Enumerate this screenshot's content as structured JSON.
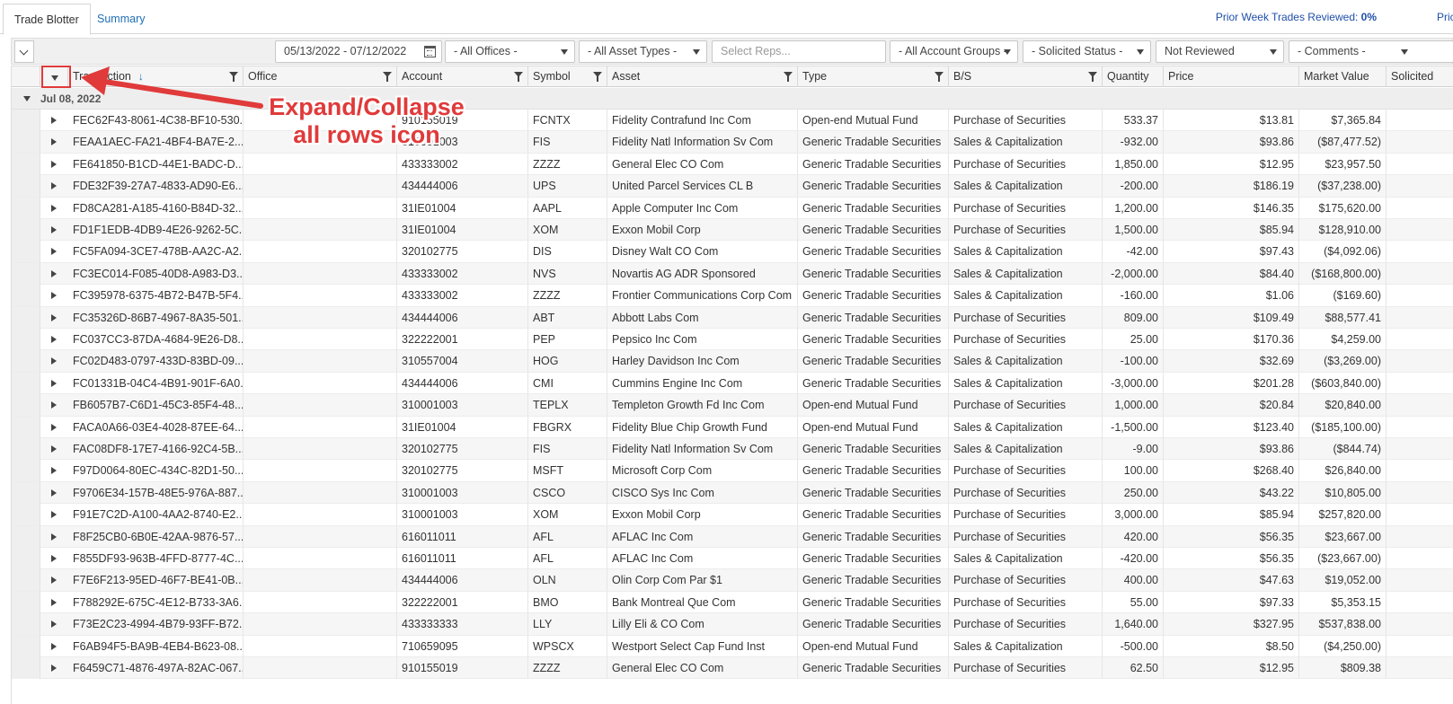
{
  "tabs": [
    {
      "label": "Trade Blotter",
      "active": true
    },
    {
      "label": "Summary",
      "active": false
    }
  ],
  "prior_week": {
    "label": "Prior Week Trades Reviewed: ",
    "value": "0%",
    "truncated": "Pric"
  },
  "toolbar": {
    "date_range": "05/13/2022 - 07/12/2022",
    "offices": "- All Offices -",
    "asset_types": "- All Asset Types -",
    "reps_placeholder": "Select Reps...",
    "account_groups": "- All Account Groups -",
    "solicited": "- Solicited Status -",
    "review": "Not Reviewed",
    "comments": "- Comments -"
  },
  "columns": [
    "Transaction",
    "Office",
    "Account",
    "Symbol",
    "Asset",
    "Type",
    "B/S",
    "Quantity",
    "Price",
    "Market Value",
    "Solicited"
  ],
  "group_label": "Jul 08, 2022",
  "annotation": {
    "line1": "Expand/Collapse",
    "line2": "all rows icon"
  },
  "rows": [
    [
      "FEC62F43-8061-4C38-BF10-530...",
      "",
      "910155019",
      "FCNTX",
      "Fidelity Contrafund Inc Com",
      "Open-end Mutual Fund",
      "Purchase of Securities",
      "533.37",
      "$13.81",
      "$7,365.84"
    ],
    [
      "FEAA1AEC-FA21-4BF4-BA7E-2...",
      "",
      "310001003",
      "FIS",
      "Fidelity Natl Information Sv Com",
      "Generic Tradable Securities",
      "Sales & Capitalization",
      "-932.00",
      "$93.86",
      "($87,477.52)"
    ],
    [
      "FE641850-B1CD-44E1-BADC-D...",
      "",
      "433333002",
      "ZZZZ",
      "General Elec CO Com",
      "Generic Tradable Securities",
      "Purchase of Securities",
      "1,850.00",
      "$12.95",
      "$23,957.50"
    ],
    [
      "FDE32F39-27A7-4833-AD90-E6...",
      "",
      "434444006",
      "UPS",
      "United Parcel Services CL B",
      "Generic Tradable Securities",
      "Sales & Capitalization",
      "-200.00",
      "$186.19",
      "($37,238.00)"
    ],
    [
      "FD8CA281-A185-4160-B84D-32...",
      "",
      "31IE01004",
      "AAPL",
      "Apple Computer Inc Com",
      "Generic Tradable Securities",
      "Purchase of Securities",
      "1,200.00",
      "$146.35",
      "$175,620.00"
    ],
    [
      "FD1F1EDB-4DB9-4E26-9262-5C...",
      "",
      "31IE01004",
      "XOM",
      "Exxon Mobil Corp",
      "Generic Tradable Securities",
      "Purchase of Securities",
      "1,500.00",
      "$85.94",
      "$128,910.00"
    ],
    [
      "FC5FA094-3CE7-478B-AA2C-A2...",
      "",
      "320102775",
      "DIS",
      "Disney Walt CO Com",
      "Generic Tradable Securities",
      "Sales & Capitalization",
      "-42.00",
      "$97.43",
      "($4,092.06)"
    ],
    [
      "FC3EC014-F085-40D8-A983-D3...",
      "",
      "433333002",
      "NVS",
      "Novartis AG ADR Sponsored",
      "Generic Tradable Securities",
      "Sales & Capitalization",
      "-2,000.00",
      "$84.40",
      "($168,800.00)"
    ],
    [
      "FC395978-6375-4B72-B47B-5F4...",
      "",
      "433333002",
      "ZZZZ",
      "Frontier Communications Corp Com",
      "Generic Tradable Securities",
      "Sales & Capitalization",
      "-160.00",
      "$1.06",
      "($169.60)"
    ],
    [
      "FC35326D-86B7-4967-8A35-501...",
      "",
      "434444006",
      "ABT",
      "Abbott Labs Com",
      "Generic Tradable Securities",
      "Purchase of Securities",
      "809.00",
      "$109.49",
      "$88,577.41"
    ],
    [
      "FC037CC3-87DA-4684-9E26-D8...",
      "",
      "322222001",
      "PEP",
      "Pepsico Inc Com",
      "Generic Tradable Securities",
      "Purchase of Securities",
      "25.00",
      "$170.36",
      "$4,259.00"
    ],
    [
      "FC02D483-0797-433D-83BD-09...",
      "",
      "310557004",
      "HOG",
      "Harley Davidson Inc Com",
      "Generic Tradable Securities",
      "Sales & Capitalization",
      "-100.00",
      "$32.69",
      "($3,269.00)"
    ],
    [
      "FC01331B-04C4-4B91-901F-6A0...",
      "",
      "434444006",
      "CMI",
      "Cummins Engine Inc Com",
      "Generic Tradable Securities",
      "Sales & Capitalization",
      "-3,000.00",
      "$201.28",
      "($603,840.00)"
    ],
    [
      "FB6057B7-C6D1-45C3-85F4-48...",
      "",
      "310001003",
      "TEPLX",
      "Templeton Growth Fd Inc Com",
      "Open-end Mutual Fund",
      "Purchase of Securities",
      "1,000.00",
      "$20.84",
      "$20,840.00"
    ],
    [
      "FACA0A66-03E4-4028-87EE-64...",
      "",
      "31IE01004",
      "FBGRX",
      "Fidelity Blue Chip Growth Fund",
      "Open-end Mutual Fund",
      "Sales & Capitalization",
      "-1,500.00",
      "$123.40",
      "($185,100.00)"
    ],
    [
      "FAC08DF8-17E7-4166-92C4-5B...",
      "",
      "320102775",
      "FIS",
      "Fidelity Natl Information Sv Com",
      "Generic Tradable Securities",
      "Sales & Capitalization",
      "-9.00",
      "$93.86",
      "($844.74)"
    ],
    [
      "F97D0064-80EC-434C-82D1-50...",
      "",
      "320102775",
      "MSFT",
      "Microsoft Corp Com",
      "Generic Tradable Securities",
      "Purchase of Securities",
      "100.00",
      "$268.40",
      "$26,840.00"
    ],
    [
      "F9706E34-157B-48E5-976A-887...",
      "",
      "310001003",
      "CSCO",
      "CISCO Sys Inc Com",
      "Generic Tradable Securities",
      "Purchase of Securities",
      "250.00",
      "$43.22",
      "$10,805.00"
    ],
    [
      "F91E7C2D-A100-4AA2-8740-E2...",
      "",
      "310001003",
      "XOM",
      "Exxon Mobil Corp",
      "Generic Tradable Securities",
      "Purchase of Securities",
      "3,000.00",
      "$85.94",
      "$257,820.00"
    ],
    [
      "F8F25CB0-6B0E-42AA-9876-57...",
      "",
      "616011011",
      "AFL",
      "AFLAC Inc Com",
      "Generic Tradable Securities",
      "Purchase of Securities",
      "420.00",
      "$56.35",
      "$23,667.00"
    ],
    [
      "F855DF93-963B-4FFD-8777-4C...",
      "",
      "616011011",
      "AFL",
      "AFLAC Inc Com",
      "Generic Tradable Securities",
      "Sales & Capitalization",
      "-420.00",
      "$56.35",
      "($23,667.00)"
    ],
    [
      "F7E6F213-95ED-46F7-BE41-0B...",
      "",
      "434444006",
      "OLN",
      "Olin Corp Com Par $1",
      "Generic Tradable Securities",
      "Purchase of Securities",
      "400.00",
      "$47.63",
      "$19,052.00"
    ],
    [
      "F788292E-675C-4E12-B733-3A6...",
      "",
      "322222001",
      "BMO",
      "Bank Montreal Que Com",
      "Generic Tradable Securities",
      "Purchase of Securities",
      "55.00",
      "$97.33",
      "$5,353.15"
    ],
    [
      "F73E2C23-4994-4B79-93FF-B72...",
      "",
      "433333333",
      "LLY",
      "Lilly Eli & CO Com",
      "Generic Tradable Securities",
      "Purchase of Securities",
      "1,640.00",
      "$327.95",
      "$537,838.00"
    ],
    [
      "F6AB94F5-BA9B-4EB4-B623-08...",
      "",
      "710659095",
      "WPSCX",
      "Westport Select Cap Fund Inst",
      "Open-end Mutual Fund",
      "Sales & Capitalization",
      "-500.00",
      "$8.50",
      "($4,250.00)"
    ],
    [
      "F6459C71-4876-497A-82AC-067...",
      "",
      "910155019",
      "ZZZZ",
      "General Elec CO Com",
      "Generic Tradable Securities",
      "Purchase of Securities",
      "62.50",
      "$12.95",
      "$809.38"
    ]
  ]
}
